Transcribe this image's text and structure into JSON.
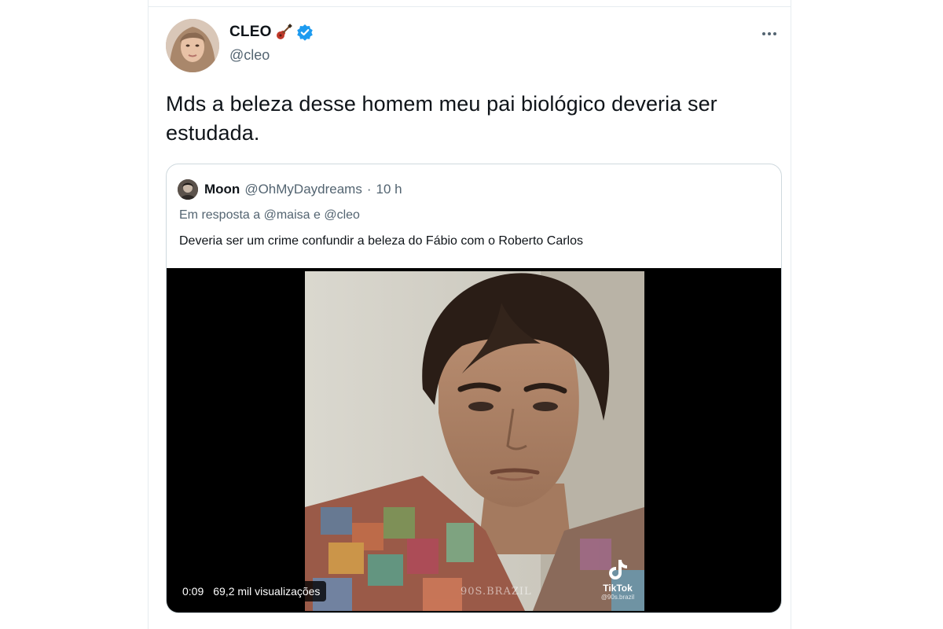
{
  "tweet": {
    "author_name": "CLEO",
    "author_handle": "@cleo",
    "text": "Mds a beleza desse homem meu pai biológico deveria ser estudada.",
    "more_icon": "more-horizontal-icon",
    "verified_icon": "verified-badge-icon",
    "name_emoji": "guitar-emoji"
  },
  "quote": {
    "author_name": "Moon",
    "author_handle": "@OhMyDaydreams",
    "separator": "·",
    "time": "10 h",
    "reply_prefix": "Em resposta a",
    "reply_mention_1": "@maisa",
    "reply_joiner": "e",
    "reply_mention_2": "@cleo",
    "text": "Deveria ser um crime confundir a beleza do Fábio com o Roberto Carlos"
  },
  "video": {
    "time": "0:09",
    "views": "69,2 mil visualizações",
    "watermark": "90S.BRAZIL",
    "tiktok_label": "TikTok",
    "tiktok_handle": "@90s.brazil"
  },
  "colors": {
    "text_primary": "#0f1419",
    "text_secondary": "#536471",
    "border": "#cfd9de",
    "verified": "#1d9bf0",
    "media_bg": "#000000"
  }
}
